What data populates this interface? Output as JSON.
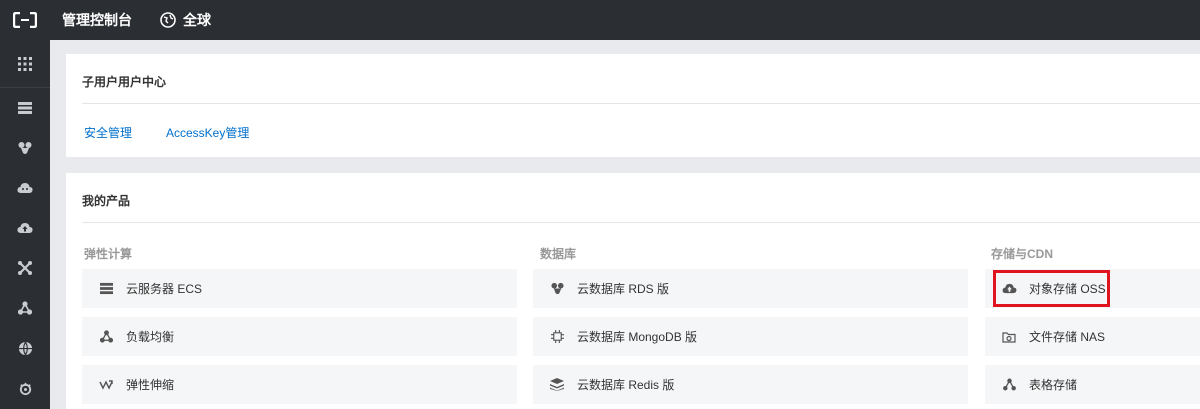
{
  "header": {
    "console_title": "管理控制台",
    "region_label": "全球"
  },
  "sidebar": {
    "icons": [
      "grid-icon",
      "server-icon",
      "database-icon",
      "cloud-icon",
      "upload-cloud-icon",
      "network-icon",
      "share-nodes-icon",
      "globe-icon",
      "gear-icon"
    ]
  },
  "subuser_center": {
    "title": "子用户用户中心",
    "links": [
      "安全管理",
      "AccessKey管理"
    ]
  },
  "my_products": {
    "title": "我的产品",
    "columns": [
      {
        "title": "弹性计算",
        "items": [
          {
            "label": "云服务器 ECS",
            "icon": "server-icon"
          },
          {
            "label": "负载均衡",
            "icon": "share-nodes-icon"
          },
          {
            "label": "弹性伸缩",
            "icon": "scale-icon"
          }
        ]
      },
      {
        "title": "数据库",
        "items": [
          {
            "label": "云数据库 RDS 版",
            "icon": "database-icon"
          },
          {
            "label": "云数据库 MongoDB 版",
            "icon": "chip-icon"
          },
          {
            "label": "云数据库 Redis 版",
            "icon": "layers-icon"
          }
        ]
      },
      {
        "title": "存储与CDN",
        "items": [
          {
            "label": "对象存储 OSS",
            "icon": "cloud-icon"
          },
          {
            "label": "文件存储 NAS",
            "icon": "folder-icon"
          },
          {
            "label": "表格存储",
            "icon": "share-nodes-icon"
          }
        ]
      }
    ]
  },
  "colors": {
    "topbar": "#2b2e33",
    "link": "#0070cc",
    "highlight": "#e0141e"
  }
}
